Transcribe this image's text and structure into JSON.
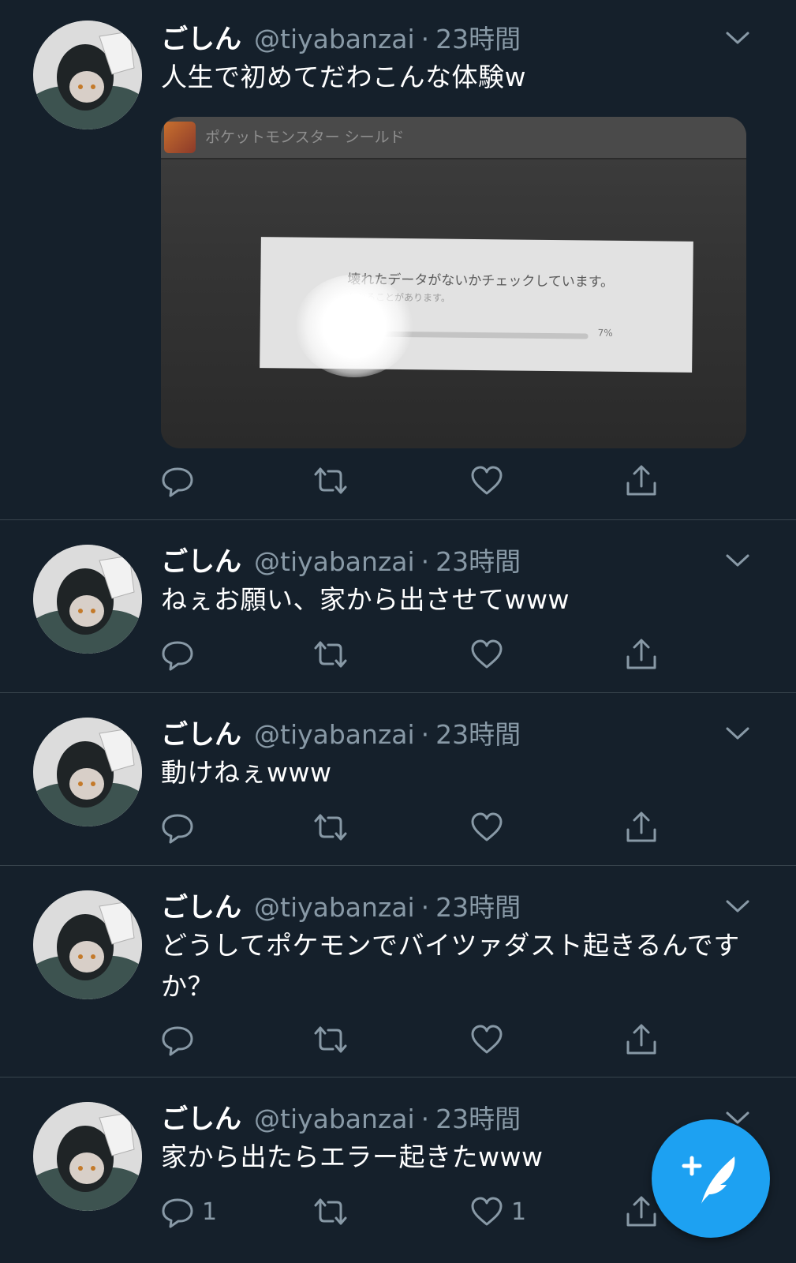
{
  "colors": {
    "background": "#15202b",
    "text_primary": "#ffffff",
    "text_secondary": "#8899a6",
    "divider": "#38444d",
    "accent": "#1da1f2"
  },
  "tweets": [
    {
      "name": "ごしん",
      "handle": "@tiyabanzai",
      "dot": "·",
      "time": "23時間",
      "text": "人生で初めてだわこんな体験w",
      "media": {
        "game_title": "ポケットモンスター シールド",
        "dialog_message": "壊れたデータがないかチェックしています。",
        "dialog_sub": "かかることがあります。",
        "progress_label": "7%",
        "progress_fraction": 0.07
      },
      "reply_count": "",
      "retweet_count": "",
      "like_count": ""
    },
    {
      "name": "ごしん",
      "handle": "@tiyabanzai",
      "dot": "·",
      "time": "23時間",
      "text": "ねぇお願い、家から出させてwww",
      "reply_count": "",
      "retweet_count": "",
      "like_count": ""
    },
    {
      "name": "ごしん",
      "handle": "@tiyabanzai",
      "dot": "·",
      "time": "23時間",
      "text": "動けねぇwww",
      "reply_count": "",
      "retweet_count": "",
      "like_count": ""
    },
    {
      "name": "ごしん",
      "handle": "@tiyabanzai",
      "dot": "·",
      "time": "23時間",
      "text": "どうしてポケモンでバイツァダスト起きるんですか？",
      "reply_count": "",
      "retweet_count": "",
      "like_count": ""
    },
    {
      "name": "ごしん",
      "handle": "@tiyabanzai",
      "dot": "·",
      "time": "23時間",
      "text": "家から出たらエラー起きたwww",
      "reply_count": "1",
      "retweet_count": "",
      "like_count": "1"
    }
  ],
  "icons": {
    "reply": "reply-icon",
    "retweet": "retweet-icon",
    "like": "like-icon",
    "share": "share-icon",
    "more": "chevron-down-icon",
    "compose": "compose-tweet-icon"
  }
}
